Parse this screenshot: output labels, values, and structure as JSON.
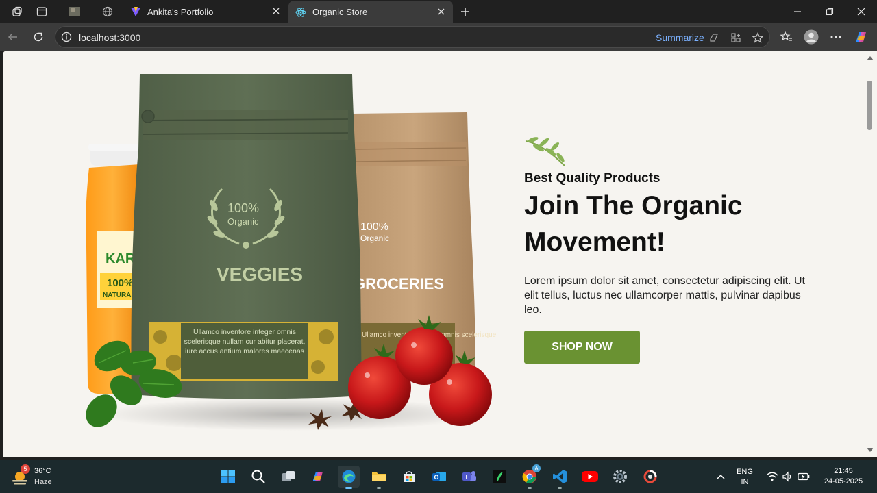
{
  "browser": {
    "tabs": [
      {
        "label": "Ankita's Portfolio"
      },
      {
        "label": "Organic Store"
      }
    ],
    "url": "localhost:3000",
    "summarize_label": "Summarize"
  },
  "hero": {
    "subtitle": "Best Quality Products",
    "headline": "Join The Organic Movement!",
    "description": "Lorem ipsum dolor sit amet, consectetur adipiscing elit. Ut elit tellus, luctus nec ullamcorper mattis, pulvinar dapibus leo.",
    "button_label": "SHOP NOW",
    "accent_color": "#6a9232",
    "product_image": {
      "bag_left_badge_1": "100%",
      "bag_left_badge_2": "Organic",
      "bag_left_name": "VEGGIES",
      "bag_left_label": "Ullamco inventore integer omnis scelerisque nullam cur abitur placerat, iure accus antium malores maecenas",
      "bag_right_badge_1": "100%",
      "bag_right_badge_2": "Organic",
      "bag_right_name": "GROCERIES",
      "bag_right_label": "Ullamco inventore integer omnis scelerisque",
      "jar_label_1": "100%",
      "jar_label_2": "NATURAL",
      "jar_brand": "KARI"
    }
  },
  "taskbar": {
    "weather": {
      "temp": "36°C",
      "condition": "Haze",
      "badge": "5"
    },
    "language": {
      "line1": "ENG",
      "line2": "IN"
    },
    "clock": {
      "time": "21:45",
      "date": "24-05-2025"
    }
  }
}
